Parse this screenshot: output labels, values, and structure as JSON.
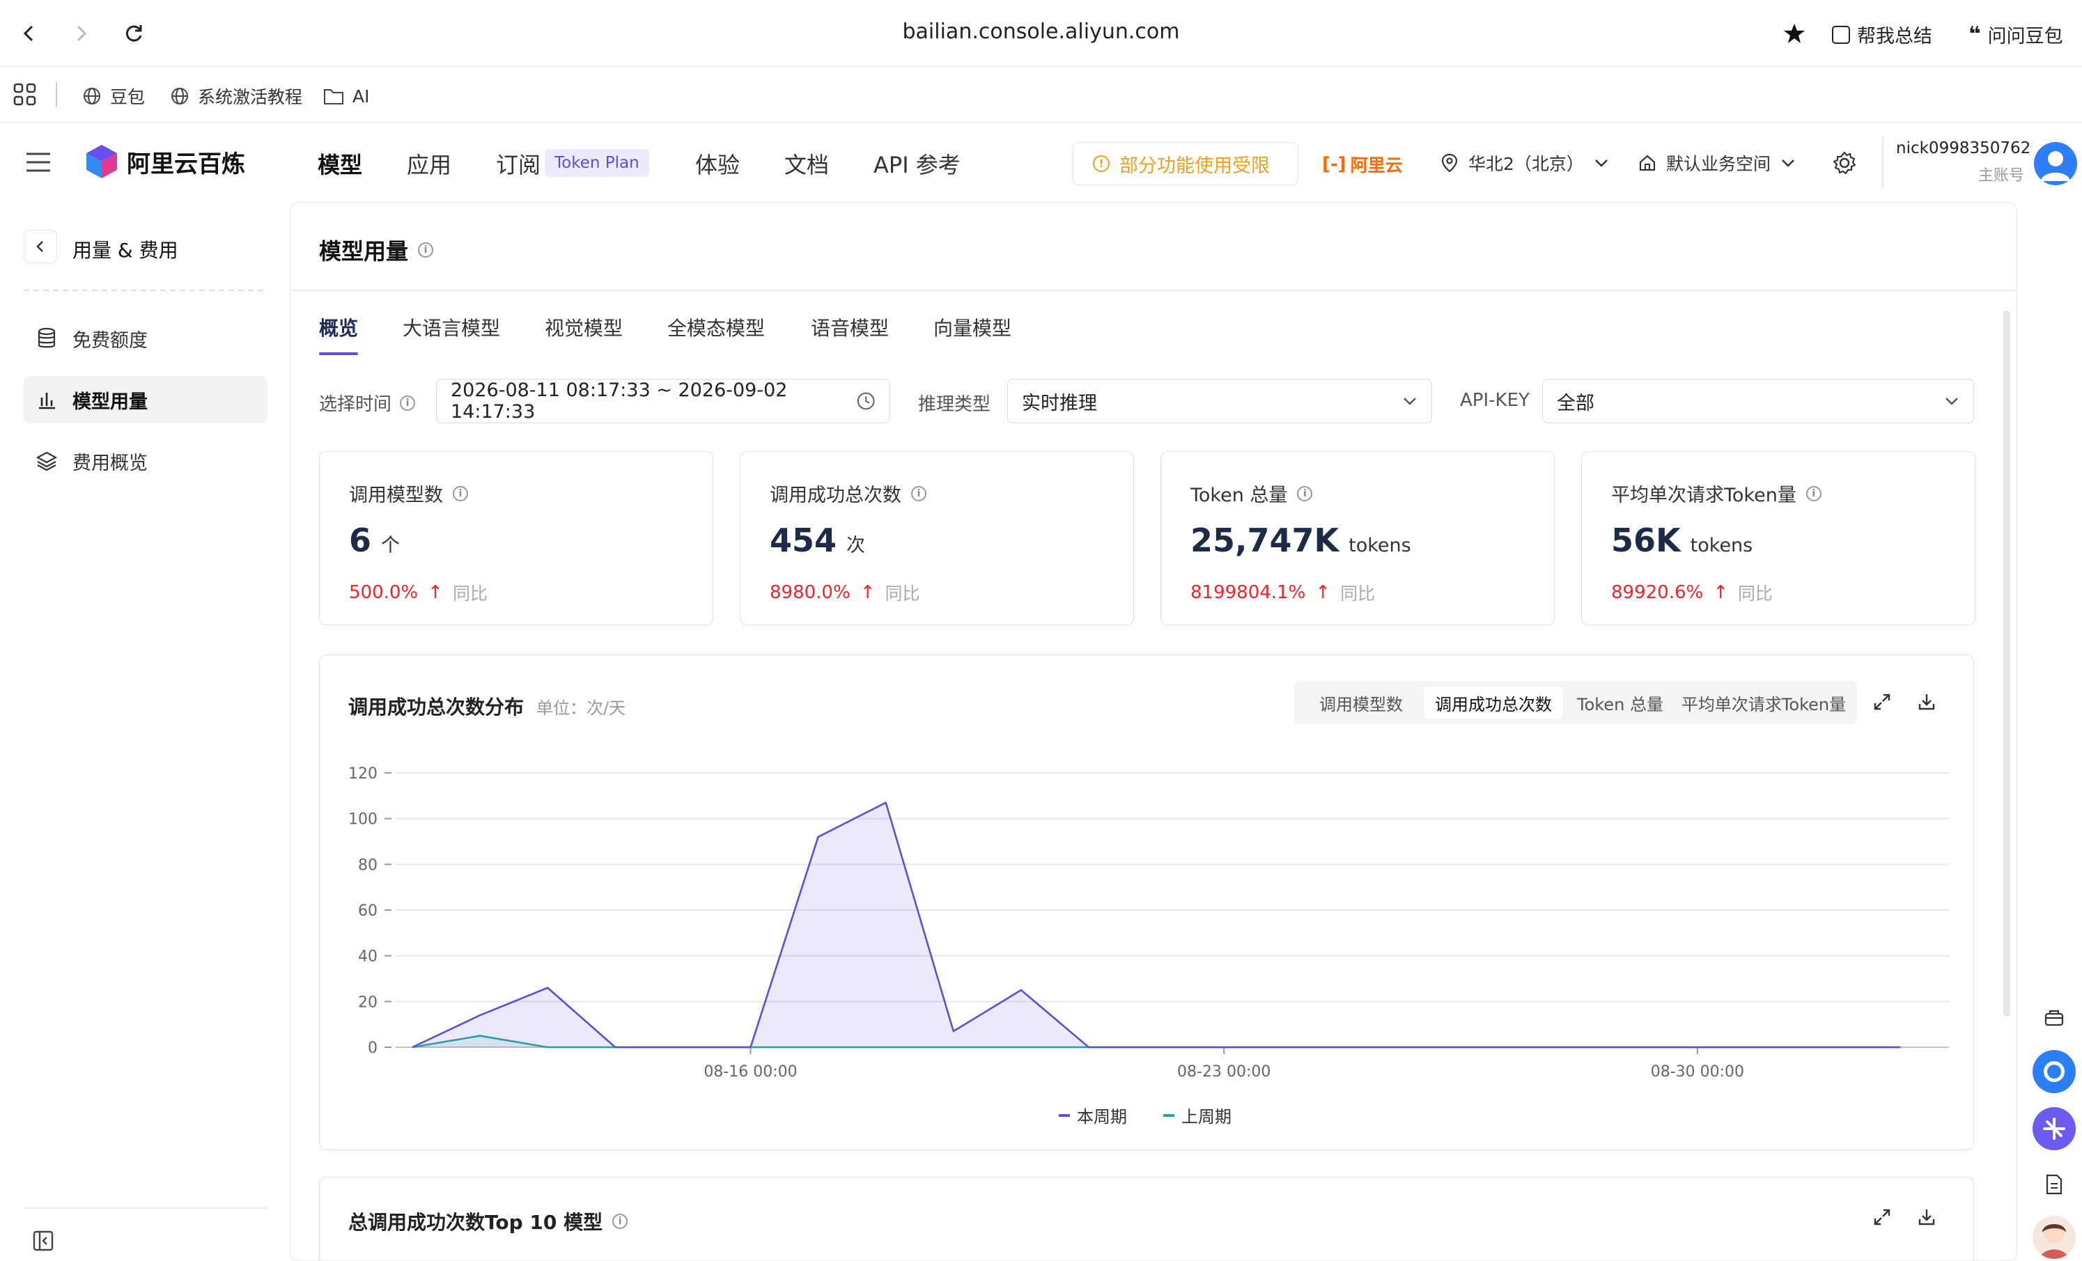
{
  "browser": {
    "url": "bailian.console.aliyun.com",
    "summarize_label": "帮我总结",
    "ask_label": "问问豆包"
  },
  "bookmarks": [
    {
      "label": "豆包",
      "icon": "globe-icon"
    },
    {
      "label": "系统激活教程",
      "icon": "globe-icon"
    },
    {
      "label": "AI",
      "icon": "folder-icon"
    }
  ],
  "header": {
    "logo_text": "阿里云百炼",
    "nav": [
      {
        "label": "模型",
        "active": true
      },
      {
        "label": "应用"
      },
      {
        "label": "订阅"
      },
      {
        "label": "体验"
      },
      {
        "label": "文档"
      },
      {
        "label": "API 参考"
      }
    ],
    "token_plan_badge": "Token Plan",
    "warning_label": "部分功能使用受限",
    "aliyun_brand": "阿里云",
    "region": "华北2（北京）",
    "workspace": "默认业务空间",
    "user_name": "nick0998350762",
    "user_role": "主账号"
  },
  "sidebar": {
    "back_title": "用量 & 费用",
    "items": [
      {
        "label": "免费额度",
        "icon": "database-icon"
      },
      {
        "label": "模型用量",
        "icon": "bar-chart-icon",
        "active": true
      },
      {
        "label": "费用概览",
        "icon": "layers-icon"
      }
    ]
  },
  "main": {
    "title": "模型用量",
    "tabs": [
      "概览",
      "大语言模型",
      "视觉模型",
      "全模态模型",
      "语音模型",
      "向量模型"
    ],
    "filters": {
      "time_label": "选择时间",
      "time_value": "2026-08-11 08:17:33 ~ 2026-09-02 14:17:33",
      "infer_label": "推理类型",
      "infer_value": "实时推理",
      "apikey_label": "API-KEY",
      "apikey_value": "全部"
    },
    "cards": [
      {
        "title": "调用模型数",
        "value": "6",
        "unit": "个",
        "pct": "500.0%",
        "cmp": "同比"
      },
      {
        "title": "调用成功总次数",
        "value": "454",
        "unit": "次",
        "pct": "8980.0%",
        "cmp": "同比"
      },
      {
        "title": "Token 总量",
        "value": "25,747K",
        "unit": "tokens",
        "pct": "8199804.1%",
        "cmp": "同比"
      },
      {
        "title": "平均单次请求Token量",
        "value": "56K",
        "unit": "tokens",
        "pct": "89920.6%",
        "cmp": "同比"
      }
    ],
    "chart_panel": {
      "title": "调用成功总次数分布",
      "unit": "单位：次/天",
      "segments": [
        "调用模型数",
        "调用成功总次数",
        "Token 总量",
        "平均单次请求Token量"
      ],
      "active_segment": 1
    },
    "top10_title": "总调用成功次数Top 10 模型"
  },
  "chart_data": {
    "type": "area",
    "title": "调用成功总次数分布",
    "ylim": [
      0,
      120
    ],
    "yticks": [
      0,
      20,
      40,
      60,
      80,
      100,
      120
    ],
    "x": [
      "08-11",
      "08-12",
      "08-13",
      "08-14",
      "08-15",
      "08-16",
      "08-17",
      "08-18",
      "08-19",
      "08-20",
      "08-21",
      "08-22",
      "08-23",
      "08-24",
      "08-25",
      "08-26",
      "08-27",
      "08-28",
      "08-29",
      "08-30",
      "08-31",
      "09-01",
      "09-02"
    ],
    "xtick_labels": [
      {
        "x": "08-16",
        "label": "08-16 00:00"
      },
      {
        "x": "08-23",
        "label": "08-23 00:00"
      },
      {
        "x": "08-30",
        "label": "08-30 00:00"
      }
    ],
    "series": [
      {
        "name": "本周期",
        "color": "#5b4fd6",
        "values": [
          0,
          14,
          26,
          0,
          0,
          0,
          92,
          107,
          7,
          25,
          0,
          0,
          0,
          0,
          0,
          0,
          0,
          0,
          0,
          0,
          0,
          0,
          0
        ]
      },
      {
        "name": "上周期",
        "color": "#2aa79b",
        "values": [
          0,
          5,
          0,
          0,
          0,
          0,
          0,
          0,
          0,
          0,
          0,
          0,
          0,
          0,
          0,
          0,
          0,
          0,
          0,
          0,
          0,
          0,
          0
        ]
      }
    ],
    "grid": true,
    "legend": "bottom-center"
  }
}
